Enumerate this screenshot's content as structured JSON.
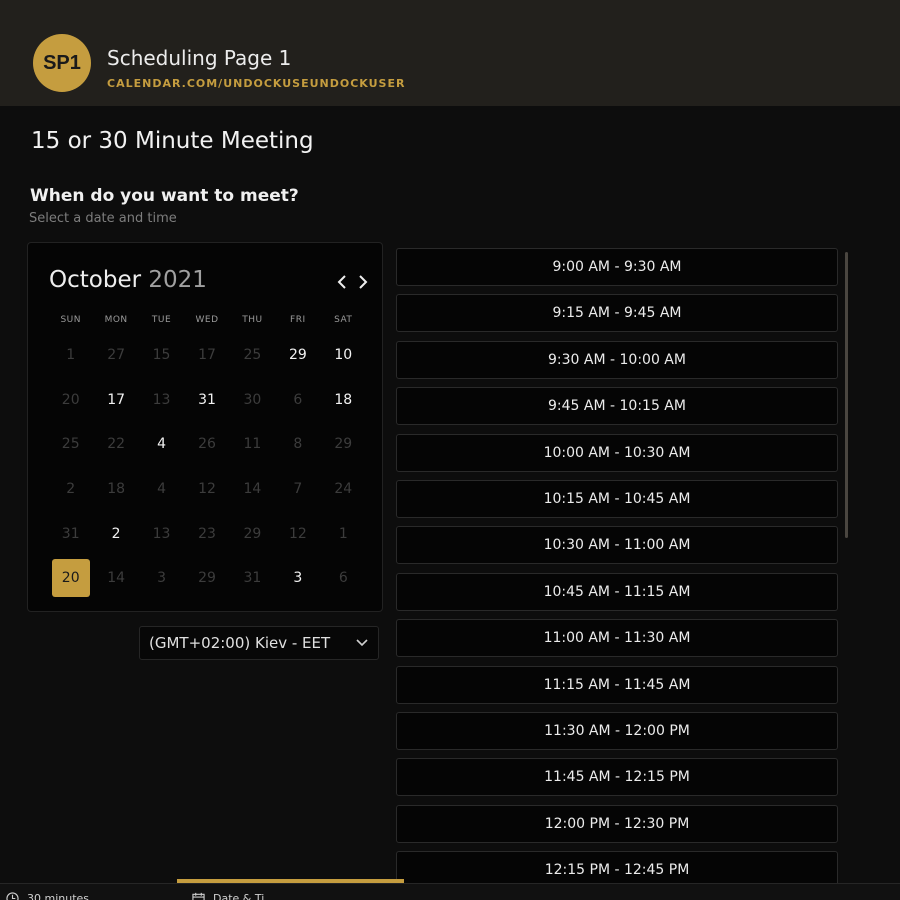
{
  "header": {
    "avatar_initials": "SP1",
    "page_name": "Scheduling Page 1",
    "page_url": "CALENDAR.COM/UNDOCKUSEUNDOCKUSER"
  },
  "meeting": {
    "title": "15 or 30 Minute Meeting",
    "question": "When do you want to meet?",
    "hint": "Select a date and time"
  },
  "calendar": {
    "month": "October",
    "year": "2021",
    "weekdays": [
      "SUN",
      "MON",
      "TUE",
      "WED",
      "THU",
      "FRI",
      "SAT"
    ],
    "days": [
      {
        "label": "1",
        "available": false
      },
      {
        "label": "27",
        "available": false
      },
      {
        "label": "15",
        "available": false
      },
      {
        "label": "17",
        "available": false
      },
      {
        "label": "25",
        "available": false
      },
      {
        "label": "29",
        "available": true
      },
      {
        "label": "10",
        "available": true
      },
      {
        "label": "20",
        "available": false
      },
      {
        "label": "17",
        "available": true
      },
      {
        "label": "13",
        "available": false
      },
      {
        "label": "31",
        "available": true
      },
      {
        "label": "30",
        "available": false
      },
      {
        "label": "6",
        "available": false
      },
      {
        "label": "18",
        "available": true
      },
      {
        "label": "25",
        "available": false
      },
      {
        "label": "22",
        "available": false
      },
      {
        "label": "4",
        "available": true
      },
      {
        "label": "26",
        "available": false
      },
      {
        "label": "11",
        "available": false
      },
      {
        "label": "8",
        "available": false
      },
      {
        "label": "29",
        "available": false
      },
      {
        "label": "2",
        "available": false
      },
      {
        "label": "18",
        "available": false
      },
      {
        "label": "4",
        "available": false
      },
      {
        "label": "12",
        "available": false
      },
      {
        "label": "14",
        "available": false
      },
      {
        "label": "7",
        "available": false
      },
      {
        "label": "24",
        "available": false
      },
      {
        "label": "31",
        "available": false
      },
      {
        "label": "2",
        "available": true
      },
      {
        "label": "13",
        "available": false
      },
      {
        "label": "23",
        "available": false
      },
      {
        "label": "29",
        "available": false
      },
      {
        "label": "12",
        "available": false
      },
      {
        "label": "1",
        "available": false
      },
      {
        "label": "20",
        "available": true,
        "selected": true
      },
      {
        "label": "14",
        "available": false
      },
      {
        "label": "3",
        "available": false
      },
      {
        "label": "29",
        "available": false
      },
      {
        "label": "31",
        "available": false
      },
      {
        "label": "3",
        "available": true
      },
      {
        "label": "6",
        "available": false
      }
    ]
  },
  "timezone": {
    "selected": "(GMT+02:00) Kiev - EET"
  },
  "time_slots": [
    "9:00 AM - 9:30 AM",
    "9:15 AM - 9:45 AM",
    "9:30 AM - 10:00 AM",
    "9:45 AM - 10:15 AM",
    "10:00 AM - 10:30 AM",
    "10:15 AM - 10:45 AM",
    "10:30 AM - 11:00 AM",
    "10:45 AM - 11:15 AM",
    "11:00 AM - 11:30 AM",
    "11:15 AM - 11:45 AM",
    "11:30 AM - 12:00 PM",
    "11:45 AM - 12:15 PM",
    "12:00 PM - 12:30 PM",
    "12:15 PM - 12:45 PM"
  ],
  "footer": {
    "duration_label": "30 minutes",
    "date_time_label": "Date & Ti"
  },
  "colors": {
    "accent": "#c59d3f",
    "header_bg": "#22201c",
    "page_bg": "#0d0d0d"
  }
}
